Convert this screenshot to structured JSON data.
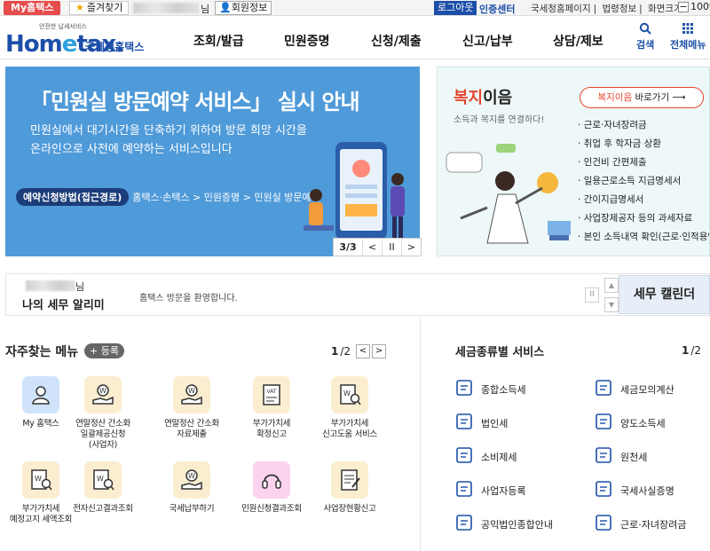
{
  "topbar": {
    "my_home": "My홈택스",
    "favorites": "즐겨찾기",
    "user_suffix": "님",
    "member_info": "회원정보",
    "logout": "로그아웃",
    "cert_center": "인증센터",
    "links": [
      "국세청홈페이지",
      "법령정보",
      "화면크기"
    ],
    "zoom": "100%"
  },
  "header": {
    "logo_small": "안전한 납세서비스",
    "logo_word_a": "Hom",
    "logo_word_e": "e",
    "logo_word_b": "tax.",
    "logo_kor": "국세청홈택스",
    "nav": [
      "조회/발급",
      "민원증명",
      "신청/제출",
      "신고/납부",
      "상담/제보"
    ],
    "search": "검색",
    "all_menu": "전체메뉴"
  },
  "banner": {
    "title": "「민원실 방문예약 서비스」 실시 안내",
    "desc_line1": "민원실에서 대기시간을 단축하기 위하여 방문 희망 시간을",
    "desc_line2": "온라인으로 사전에 예약하는 서비스입니다",
    "path_pill": "예약신청방법(접근경로)",
    "path": "홈택스·손택스 > 민원증명 > 민원실 방문예약",
    "counter": "3/3",
    "prev": "<",
    "pause": "II",
    "next": ">"
  },
  "welfare": {
    "title_hl": "복지",
    "title_rest": "이음",
    "subtitle": "소득과 복지를 연결하다!",
    "go_hl": "복지이음",
    "go_rest": " 바로가기 ⟶",
    "items": [
      "근로·자녀장려금",
      "취업 후 학자금 상환",
      "인건비 간편제출",
      "일용근로소득 지급명세서",
      "간이지급명세서",
      "사업장제공자 등의 과세자료",
      "본인 소득내역 확인(근로·인적용역)"
    ]
  },
  "alarm": {
    "user_suffix": "님",
    "title": "나의 세무 알리미",
    "message": "홈택스 방문을 환영합니다.",
    "calendar": "세무 캘린더"
  },
  "quick_menu": {
    "title": "자주찾는 메뉴",
    "register": "+ 등록",
    "page_current": "1",
    "page_total": "/2",
    "items": [
      {
        "label": "My 홈택스",
        "icon": "person-icon"
      },
      {
        "label": "연말정산 간소화\n일괄제공신청\n(사업자)",
        "icon": "money-hand-icon"
      },
      {
        "label": "연말정산 간소화\n자료제출",
        "icon": "money-hand-icon"
      },
      {
        "label": "부가가치세\n확정신고",
        "icon": "vat-document-icon"
      },
      {
        "label": "부가가치세\n신고도움 서비스",
        "icon": "document-search-icon"
      },
      {
        "label": "부가가치세\n예정고지 세액조회",
        "icon": "document-search-icon"
      },
      {
        "label": "전자신고결과조회",
        "icon": "document-search-icon"
      },
      {
        "label": "국세납부하기",
        "icon": "money-hand-icon"
      },
      {
        "label": "민원신청결과조회",
        "icon": "headset-icon"
      },
      {
        "label": "사업장현황신고",
        "icon": "document-pen-icon"
      }
    ]
  },
  "tax_service": {
    "title": "세금종류별 서비스",
    "page_current": "1",
    "page_total": "/2",
    "left": [
      "종합소득세",
      "법인세",
      "소비제세",
      "사업자등록",
      "공익법인종합안내"
    ],
    "right": [
      "세금모의계산",
      "양도소득세",
      "원천세",
      "국세사실증명",
      "근로·자녀장려금"
    ]
  },
  "colors": {
    "brand_blue": "#1c4fa8",
    "banner_blue": "#4f9ad9",
    "accent_red": "#e6462f",
    "welfare_bg": "#eef8f8"
  }
}
